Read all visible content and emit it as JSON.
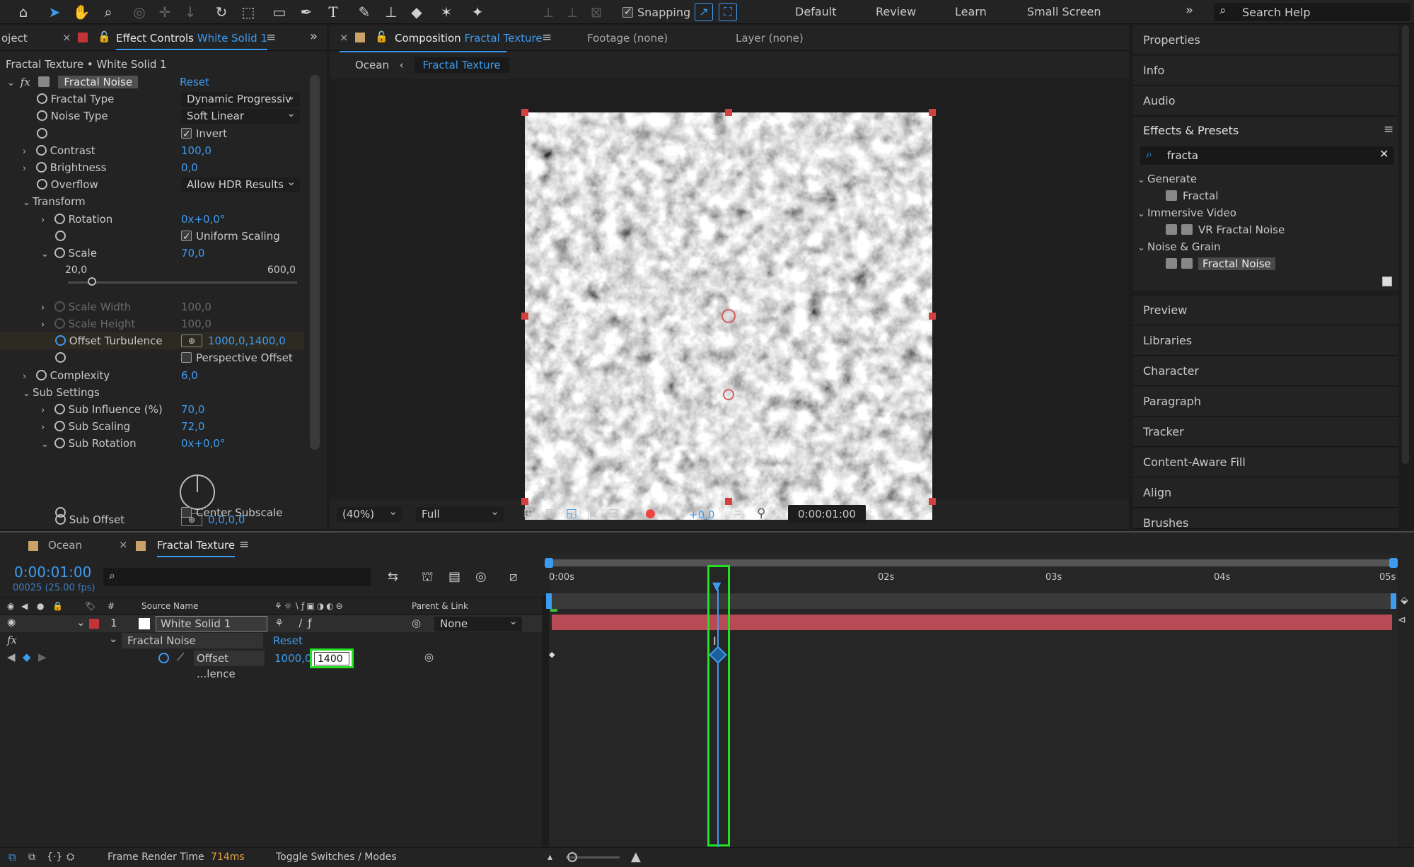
{
  "toolbar": {
    "snapping_label": "Snapping",
    "workspaces": [
      "Default",
      "Review",
      "Learn",
      "Small Screen"
    ],
    "search_placeholder": "Search Help"
  },
  "effect_controls": {
    "tab_project": "oject",
    "tab_label": "Effect Controls",
    "tab_layer": "White Solid 1",
    "breadcrumb": "Fractal Texture • White Solid 1",
    "effect_name": "Fractal Noise",
    "reset": "Reset",
    "params": {
      "fractal_type": {
        "label": "Fractal Type",
        "value": "Dynamic Progressiv"
      },
      "noise_type": {
        "label": "Noise Type",
        "value": "Soft Linear"
      },
      "invert": {
        "label": "Invert"
      },
      "contrast": {
        "label": "Contrast",
        "value": "100,0"
      },
      "brightness": {
        "label": "Brightness",
        "value": "0,0"
      },
      "overflow": {
        "label": "Overflow",
        "value": "Allow HDR Results"
      },
      "transform": {
        "label": "Transform"
      },
      "rotation": {
        "label": "Rotation",
        "value": "0x+0,0°"
      },
      "uniform_scaling": {
        "label": "Uniform Scaling"
      },
      "scale": {
        "label": "Scale",
        "value": "70,0",
        "min": "20,0",
        "max": "600,0"
      },
      "scale_width": {
        "label": "Scale Width",
        "value": "100,0"
      },
      "scale_height": {
        "label": "Scale Height",
        "value": "100,0"
      },
      "offset_turbulence": {
        "label": "Offset Turbulence",
        "value": "1000,0,1400,0"
      },
      "perspective_offset": {
        "label": "Perspective Offset"
      },
      "complexity": {
        "label": "Complexity",
        "value": "6,0"
      },
      "sub_settings": {
        "label": "Sub Settings"
      },
      "sub_influence": {
        "label": "Sub Influence (%)",
        "value": "70,0"
      },
      "sub_scaling": {
        "label": "Sub Scaling",
        "value": "72,0"
      },
      "sub_rotation": {
        "label": "Sub Rotation",
        "value": "0x+0,0°"
      },
      "sub_offset": {
        "label": "Sub Offset",
        "value": "0,0,0,0"
      },
      "center_subscale": {
        "label": "Center Subscale"
      }
    }
  },
  "composition": {
    "tab_label": "Composition",
    "tab_name": "Fractal Texture",
    "footage": "Footage (none)",
    "layer": "Layer (none)",
    "crumb_parent": "Ocean",
    "crumb_current": "Fractal Texture",
    "zoom": "(40%)",
    "resolution": "Full",
    "exposure": "+0,0",
    "timecode": "0:00:01:00"
  },
  "right_panel": {
    "top_items": [
      "Properties",
      "Info",
      "Audio"
    ],
    "effects_presets": {
      "title": "Effects & Presets",
      "search": "fracta",
      "tree": [
        {
          "category": "Generate",
          "items": [
            "Fractal"
          ]
        },
        {
          "category": "Immersive Video",
          "items": [
            "VR Fractal Noise"
          ]
        },
        {
          "category": "Noise & Grain",
          "items": [
            "Fractal Noise"
          ]
        }
      ]
    },
    "bottom_items": [
      "Preview",
      "Libraries",
      "Character",
      "Paragraph",
      "Tracker",
      "Content-Aware Fill",
      "Align",
      "Brushes"
    ]
  },
  "timeline": {
    "tabs": [
      "Ocean",
      "Fractal Texture"
    ],
    "timecode": "0:00:01:00",
    "frames": "00025 (25.00 fps)",
    "col_num": "#",
    "col_source": "Source Name",
    "col_parent": "Parent & Link",
    "layer_num": "1",
    "layer_name": "White Solid 1",
    "parent_value": "None",
    "effect_name": "Fractal Noise",
    "reset": "Reset",
    "prop_name": "Offset ...lence",
    "prop_value_x": "1000,0,",
    "prop_value_y_input": "1400",
    "ruler": [
      "0:00s",
      "02s",
      "03s",
      "04s",
      "05s"
    ],
    "playhead_fraction": 0.2,
    "footer_render_label": "Frame Render Time",
    "footer_render_value": "714ms",
    "footer_toggle": "Toggle Switches / Modes"
  },
  "colors": {
    "accent": "#3d9bf0",
    "highlight": "#22e022",
    "layer_bar": "#b84a55",
    "label_red": "#c4323a",
    "keyframe": "#e3a23c"
  }
}
